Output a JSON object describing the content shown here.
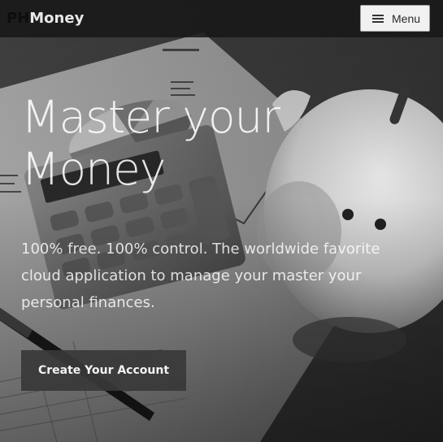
{
  "navbar": {
    "brand_prefix": "PH",
    "brand_name": "Money",
    "menu_label": "Menu"
  },
  "hero": {
    "title": "Master your Money",
    "subtitle": "100% free. 100% control. The worldwide favorite cloud application to manage your master your personal finances.",
    "cta_label": "Create Your Account"
  },
  "icons": {
    "menu": "hamburger-icon"
  }
}
